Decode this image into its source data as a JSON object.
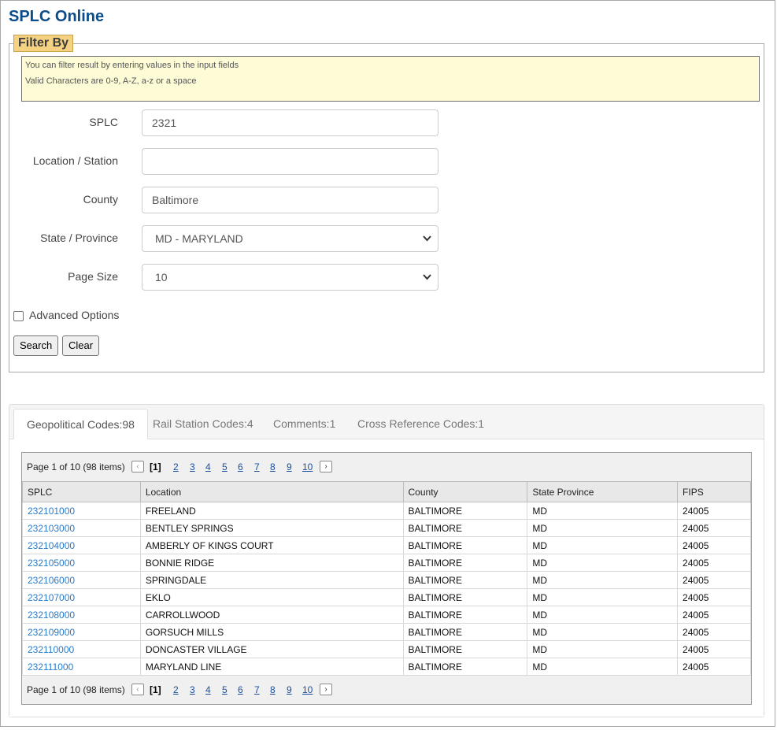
{
  "app": {
    "title": "SPLC Online"
  },
  "filter": {
    "legend": "Filter By",
    "info_lines": [
      "You can filter result by entering values in the input fields",
      "Valid Characters are 0-9, A-Z, a-z or a space"
    ],
    "fields": {
      "splc": {
        "label": "SPLC",
        "value": "2321"
      },
      "location": {
        "label": "Location / Station",
        "value": ""
      },
      "county": {
        "label": "County",
        "value": "Baltimore"
      },
      "state": {
        "label": "State / Province",
        "selected": "MD - MARYLAND"
      },
      "page_size": {
        "label": "Page Size",
        "selected": "10"
      }
    },
    "advanced_options_label": "Advanced Options",
    "search_label": "Search",
    "clear_label": "Clear"
  },
  "tabs": [
    {
      "label": "Geopolitical Codes:98",
      "active": true
    },
    {
      "label": "Rail Station Codes:4",
      "active": false
    },
    {
      "label": "Comments:1",
      "active": false
    },
    {
      "label": "Cross Reference Codes:1",
      "active": false
    }
  ],
  "pager": {
    "info": "Page 1 of 10 (98 items)",
    "current": "[1]",
    "pages": [
      "2",
      "3",
      "4",
      "5",
      "6",
      "7",
      "8",
      "9",
      "10"
    ],
    "prev_icon": "chevron-left-icon",
    "next_icon": "chevron-right-icon"
  },
  "grid": {
    "columns": [
      "SPLC",
      "Location",
      "County",
      "State Province",
      "FIPS"
    ],
    "rows": [
      [
        "232101000",
        "FREELAND",
        "BALTIMORE",
        "MD",
        "24005"
      ],
      [
        "232103000",
        "BENTLEY SPRINGS",
        "BALTIMORE",
        "MD",
        "24005"
      ],
      [
        "232104000",
        "AMBERLY OF KINGS COURT",
        "BALTIMORE",
        "MD",
        "24005"
      ],
      [
        "232105000",
        "BONNIE RIDGE",
        "BALTIMORE",
        "MD",
        "24005"
      ],
      [
        "232106000",
        "SPRINGDALE",
        "BALTIMORE",
        "MD",
        "24005"
      ],
      [
        "232107000",
        "EKLO",
        "BALTIMORE",
        "MD",
        "24005"
      ],
      [
        "232108000",
        "CARROLLWOOD",
        "BALTIMORE",
        "MD",
        "24005"
      ],
      [
        "232109000",
        "GORSUCH MILLS",
        "BALTIMORE",
        "MD",
        "24005"
      ],
      [
        "232110000",
        "DONCASTER VILLAGE",
        "BALTIMORE",
        "MD",
        "24005"
      ],
      [
        "232111000",
        "MARYLAND LINE",
        "BALTIMORE",
        "MD",
        "24005"
      ]
    ]
  }
}
